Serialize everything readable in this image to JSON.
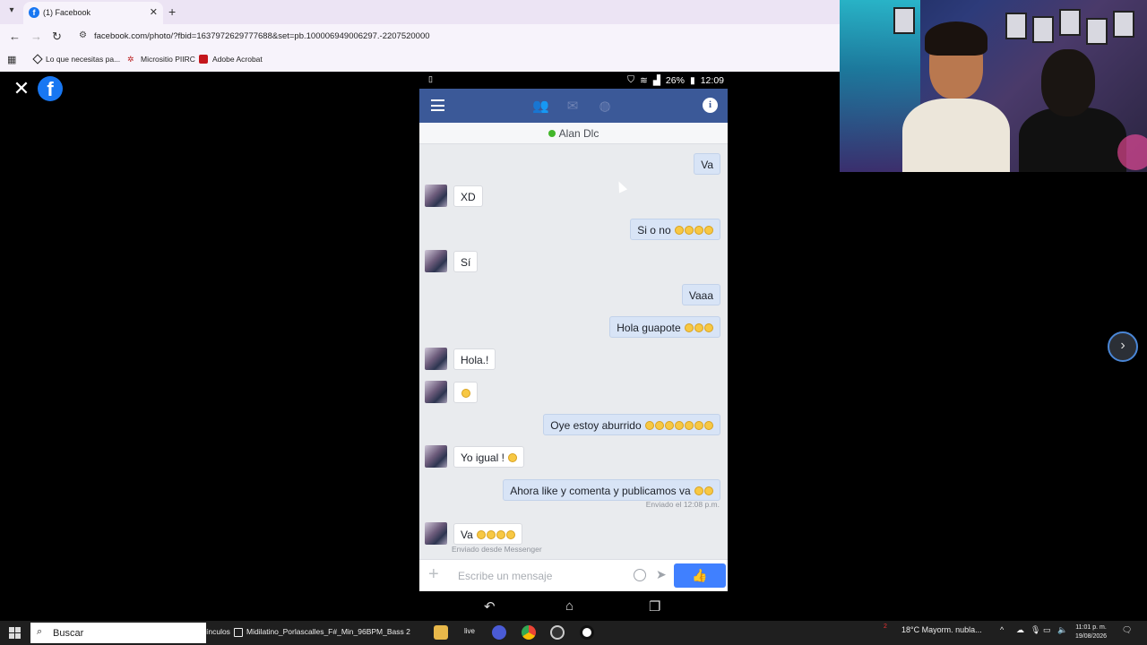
{
  "browser": {
    "tab_title": "(1) Facebook",
    "url": "facebook.com/photo/?fbid=1637972629777688&set=pb.100006949006297.-2207520000",
    "bookmarks": [
      "Lo que necesitas pa...",
      "Micrositio PIIRC",
      "Adobe Acrobat"
    ]
  },
  "phone": {
    "status": {
      "battery": "26%",
      "time": "12:09"
    },
    "contact_name": "Alan Dlc",
    "messages": [
      {
        "dir": "out",
        "text": "Va",
        "emoji": 0
      },
      {
        "dir": "in",
        "text": "XD",
        "emoji": 0
      },
      {
        "dir": "out",
        "text": "Si o no",
        "emoji": 4
      },
      {
        "dir": "in",
        "text": "Sí",
        "emoji": 0
      },
      {
        "dir": "out",
        "text": "Vaaa",
        "emoji": 0
      },
      {
        "dir": "out",
        "text": "Hola guapote",
        "emoji": 3
      },
      {
        "dir": "in",
        "text": "Hola.!",
        "emoji": 0
      },
      {
        "dir": "in",
        "text": "",
        "emoji": 1
      },
      {
        "dir": "out",
        "text": "Oye estoy aburrido",
        "emoji": 7
      },
      {
        "dir": "in",
        "text": "Yo igual !",
        "emoji": 1
      },
      {
        "dir": "out",
        "text": "Ahora like y comenta y publicamos va",
        "emoji": 2
      },
      {
        "dir": "in",
        "text": "Va",
        "emoji": 4
      }
    ],
    "sent_meta": "Enviado el 12:08 p.m.",
    "messenger_meta": "Enviado desde Messenger",
    "composer_placeholder": "Escribe un mensaje"
  },
  "taskbar": {
    "search_label": "Buscar",
    "links_label": "ínculos",
    "window_title": "Midilatino_Porlascalles_F#_Min_96BPM_Bass 2",
    "live_label": "live",
    "weather": "18°C  Mayorm. nubla...",
    "time": "11:01 p. m.",
    "date": "19/08/2026",
    "notif_count": "2"
  },
  "icons": {
    "close": "close-icon",
    "next": "chevron-right-icon",
    "like": "thumbs-up-icon"
  },
  "colors": {
    "fb_blue": "#3b5998",
    "bubble_out": "#d8e4f6",
    "like_blue": "#4080ff"
  }
}
